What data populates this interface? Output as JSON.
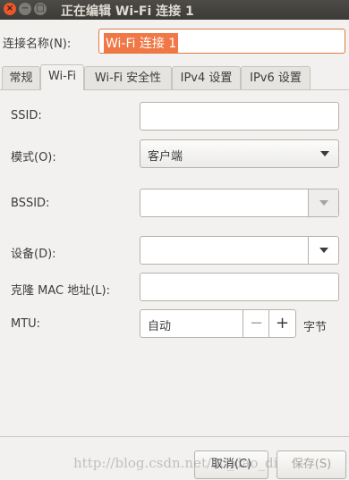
{
  "window": {
    "title": "正在编辑 Wi-Fi 连接 1",
    "close_icon": "×",
    "minimize_icon": "−",
    "maximize_icon": "□"
  },
  "connection_name": {
    "label": "连接名称(N):",
    "value": "Wi-Fi 连接 1"
  },
  "tabs": [
    {
      "label": "常规",
      "active": false
    },
    {
      "label": "Wi-Fi",
      "active": true
    },
    {
      "label": "Wi-Fi 安全性",
      "active": false
    },
    {
      "label": "IPv4 设置",
      "active": false
    },
    {
      "label": "IPv6 设置",
      "active": false
    }
  ],
  "wifi": {
    "ssid": {
      "label": "SSID:",
      "value": ""
    },
    "mode": {
      "label": "模式(O):",
      "value": "客户端"
    },
    "bssid": {
      "label": "BSSID:",
      "value": ""
    },
    "device": {
      "label": "设备(D):",
      "value": ""
    },
    "cloned_mac": {
      "label": "克隆 MAC 地址(L):",
      "value": ""
    },
    "mtu": {
      "label": "MTU:",
      "value": "自动",
      "unit": "字节",
      "minus": "−",
      "plus": "+"
    }
  },
  "buttons": {
    "cancel": "取消(C)",
    "save": "保存(S)"
  },
  "watermark": "http://blog.csdn.net/ac_dao_di",
  "colors": {
    "accent": "#f07746",
    "titlebar": "#3c3b37",
    "close": "#e9572a"
  }
}
